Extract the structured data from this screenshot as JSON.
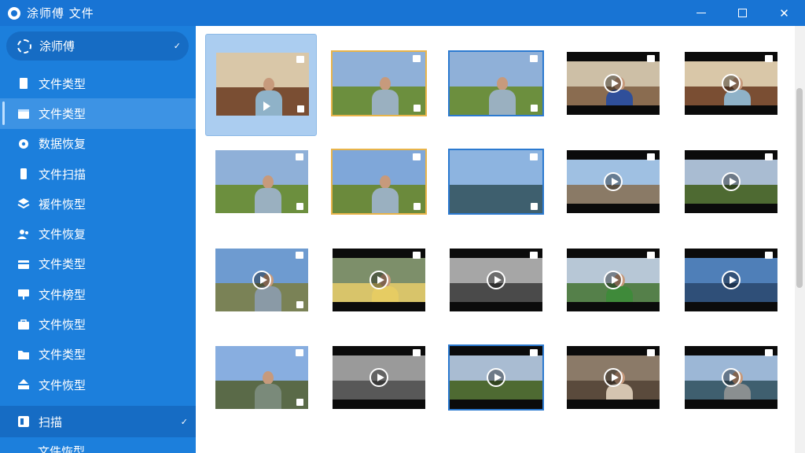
{
  "window": {
    "title": "涂师傅 文件",
    "minimize": "—",
    "maximize": "☐",
    "close": "✕"
  },
  "sidebar": {
    "header": {
      "label": "涂师傅",
      "check": "✓"
    },
    "items": [
      {
        "label": "文件类型",
        "icon": "document-icon",
        "active": false
      },
      {
        "label": "文件类型",
        "icon": "calendar-icon",
        "active": true
      },
      {
        "label": "数据恢复",
        "icon": "gear-icon",
        "active": false
      },
      {
        "label": "文件扫描",
        "icon": "phone-icon",
        "active": false
      },
      {
        "label": "褑件恢型",
        "icon": "layers-icon",
        "active": false
      },
      {
        "label": "文件恢复",
        "icon": "user-icon",
        "active": false
      },
      {
        "label": "文件类型",
        "icon": "card-icon",
        "active": false
      },
      {
        "label": "文件榜型",
        "icon": "monitor-icon",
        "active": false
      },
      {
        "label": "文件恢型",
        "icon": "briefcase-icon",
        "active": false
      },
      {
        "label": "文件类型",
        "icon": "folder-icon",
        "active": false
      },
      {
        "label": "文件恢型",
        "icon": "upload-tray-icon",
        "active": false
      }
    ],
    "scan": {
      "label": "扫描",
      "check": "✓",
      "icon": "scan-icon"
    },
    "cut_item": {
      "label": "文件恢型"
    }
  },
  "grid": {
    "tiles": [
      {
        "kind": "photo",
        "scene": "indoor",
        "border": "none",
        "selected": true
      },
      {
        "kind": "photo",
        "scene": "field",
        "border": "yellow",
        "selected": false
      },
      {
        "kind": "photo",
        "scene": "field",
        "border": "blue",
        "selected": false
      },
      {
        "kind": "video",
        "scene": "indoor-blue",
        "border": "none",
        "selected": false
      },
      {
        "kind": "video",
        "scene": "indoor",
        "border": "none",
        "selected": false
      },
      {
        "kind": "photo",
        "scene": "field",
        "border": "none",
        "selected": false
      },
      {
        "kind": "photo",
        "scene": "house",
        "border": "yellow",
        "selected": false
      },
      {
        "kind": "photo",
        "scene": "lake",
        "border": "blue",
        "selected": false
      },
      {
        "kind": "video",
        "scene": "dock",
        "border": "none",
        "selected": false
      },
      {
        "kind": "video",
        "scene": "field-dark",
        "border": "none",
        "selected": false
      },
      {
        "kind": "photo-play",
        "scene": "sky",
        "border": "none",
        "selected": false
      },
      {
        "kind": "video",
        "scene": "selfie-yellow",
        "border": "none",
        "selected": false
      },
      {
        "kind": "video",
        "scene": "gray-building",
        "border": "none",
        "selected": false
      },
      {
        "kind": "video",
        "scene": "green-shirt",
        "border": "none",
        "selected": false
      },
      {
        "kind": "video",
        "scene": "blue-sky",
        "border": "none",
        "selected": false
      },
      {
        "kind": "photo",
        "scene": "road",
        "border": "none",
        "selected": false
      },
      {
        "kind": "video",
        "scene": "gray-lake",
        "border": "none",
        "selected": false
      },
      {
        "kind": "video",
        "scene": "field-dark",
        "border": "blue",
        "selected": false
      },
      {
        "kind": "video",
        "scene": "selfie-brown",
        "border": "none",
        "selected": false
      },
      {
        "kind": "video",
        "scene": "car-field",
        "border": "none",
        "selected": false
      }
    ]
  },
  "colors": {
    "sidebar": "#1c7fdc",
    "titlebar": "#1874d4",
    "active_item": "#3d93e4",
    "yellow_border": "#e8b44a",
    "blue_border": "#2c7ad0"
  }
}
